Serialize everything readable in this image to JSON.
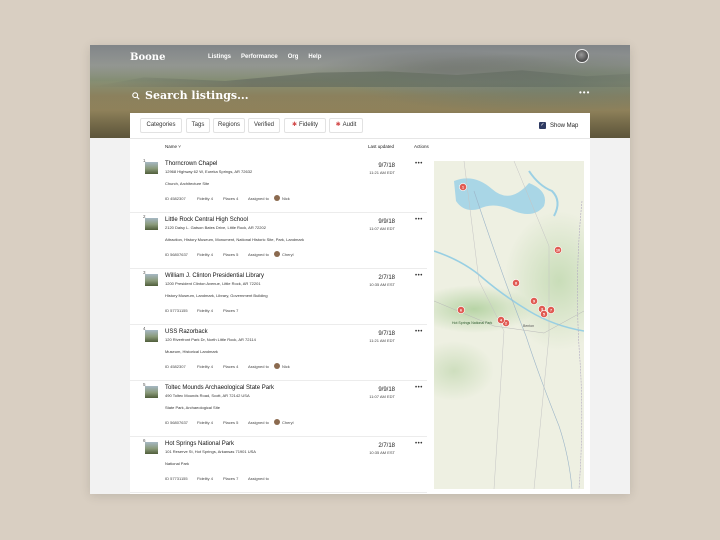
{
  "app": {
    "name": "Boone"
  },
  "nav": [
    "Listings",
    "Performance",
    "Org",
    "Help"
  ],
  "search": {
    "placeholder": "Search listings..."
  },
  "filters": [
    "Categories",
    "Tags",
    "Regions",
    "Verified",
    "Fidelity",
    "Audit"
  ],
  "show_map": {
    "label": "Show Map",
    "checked": true
  },
  "columns": {
    "name": "Name",
    "updated": "Last updated",
    "actions": "Actions"
  },
  "listings": [
    {
      "num": "1",
      "name": "Thorncrown Chapel",
      "address": "12968 Highway 62 W, Eureka Springs, AR 72632",
      "tags": "Church, Architecture Site",
      "id": "ID 4582307",
      "fidelity": "Fidelity 4",
      "places": "Places 4",
      "assigned": "Assigned to",
      "assignee": "Nick",
      "date": "9/7/18",
      "time": "11:21 AM EDT"
    },
    {
      "num": "2",
      "name": "Little Rock Central High School",
      "address": "2120 Daisy L. Gatson Bates Drive, Little Rock, AR 72202",
      "tags": "Attraction, History Museum, Monument, National Historic Site, Park, Landmark",
      "id": "ID 56807637",
      "fidelity": "Fidelity 4",
      "places": "Places 5",
      "assigned": "Assigned to",
      "assignee": "Cheryl",
      "date": "9/9/18",
      "time": "11:07 AM EDT"
    },
    {
      "num": "3",
      "name": "William J. Clinton Presidential Library",
      "address": "1200 President Clinton Avenue, Little Rock, AR 72201",
      "tags": "History Museum, Landmark, Library, Government Building",
      "id": "ID 57731155",
      "fidelity": "Fidelity 4",
      "places": "Places 7",
      "assigned": "",
      "assignee": "",
      "date": "2/7/18",
      "time": "10:35 AM EST"
    },
    {
      "num": "4",
      "name": "USS Razorback",
      "address": "120 Riverfront Park Dr, North Little Rock, AR 72114",
      "tags": "Museum, Historical Landmark",
      "id": "ID 4582307",
      "fidelity": "Fidelity 4",
      "places": "Places 4",
      "assigned": "Assigned to",
      "assignee": "Nick",
      "date": "9/7/18",
      "time": "11:21 AM EDT"
    },
    {
      "num": "5",
      "name": "Toltec Mounds Archaeological State Park",
      "address": "490 Toltec Mounds Road, Scott, AR 72142 USA",
      "tags": "State Park, Archaeological Site",
      "id": "ID 56807637",
      "fidelity": "Fidelity 4",
      "places": "Places 5",
      "assigned": "Assigned to",
      "assignee": "Cheryl",
      "date": "9/9/18",
      "time": "11:07 AM EDT"
    },
    {
      "num": "6",
      "name": "Hot Springs National Park",
      "address": "101 Reserve St, Hot Springs, Arkansas 71901 USA",
      "tags": "National Park",
      "id": "ID 57731155",
      "fidelity": "Fidelity 4",
      "places": "Places 7",
      "assigned": "Assigned to",
      "assignee": "",
      "date": "2/7/18",
      "time": "10:35 AM EST"
    }
  ],
  "map": {
    "pins": [
      "1",
      "10",
      "8",
      "9",
      "6",
      "2",
      "4",
      "3",
      "5",
      "7"
    ],
    "labels": [
      "Hot Springs National Park",
      "Benton"
    ],
    "pin_color": "#e05a52"
  }
}
